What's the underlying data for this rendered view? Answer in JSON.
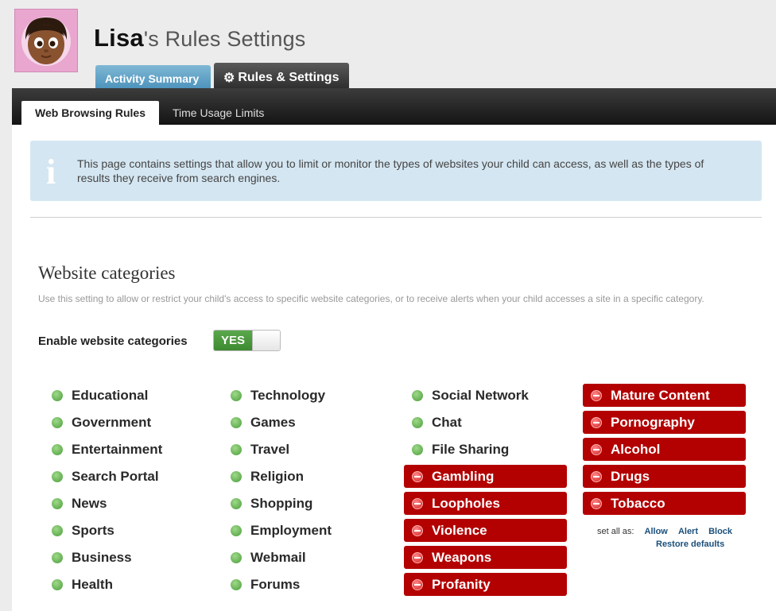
{
  "header": {
    "name": "Lisa",
    "title_suffix": "'s Rules Settings"
  },
  "tabs": {
    "activity": "Activity Summary",
    "rules": "Rules & Settings"
  },
  "subtabs": {
    "web": "Web Browsing Rules",
    "time": "Time Usage Limits"
  },
  "info": {
    "icon": "info-icon",
    "text": "This page contains settings that allow you to limit or monitor the types of websites your child can access, as well as the types of results they receive from search engines."
  },
  "section": {
    "title": "Website categories",
    "description": "Use this setting to allow or restrict your child's access to specific website categories, or to receive alerts when your child accesses a site in a specific category.",
    "enable_label": "Enable website categories",
    "toggle_label": "YES"
  },
  "colors": {
    "allow": "#4a9d39",
    "block": "#b30000",
    "tab_blue": "#4d93bc"
  },
  "categories": {
    "col1": [
      {
        "label": "Educational",
        "status": "allow"
      },
      {
        "label": "Government",
        "status": "allow"
      },
      {
        "label": "Entertainment",
        "status": "allow"
      },
      {
        "label": "Search Portal",
        "status": "allow"
      },
      {
        "label": "News",
        "status": "allow"
      },
      {
        "label": "Sports",
        "status": "allow"
      },
      {
        "label": "Business",
        "status": "allow"
      },
      {
        "label": "Health",
        "status": "allow"
      }
    ],
    "col2": [
      {
        "label": "Technology",
        "status": "allow"
      },
      {
        "label": "Games",
        "status": "allow"
      },
      {
        "label": "Travel",
        "status": "allow"
      },
      {
        "label": "Religion",
        "status": "allow"
      },
      {
        "label": "Shopping",
        "status": "allow"
      },
      {
        "label": "Employment",
        "status": "allow"
      },
      {
        "label": "Webmail",
        "status": "allow"
      },
      {
        "label": "Forums",
        "status": "allow"
      }
    ],
    "col3": [
      {
        "label": "Social Network",
        "status": "allow"
      },
      {
        "label": "Chat",
        "status": "allow"
      },
      {
        "label": "File Sharing",
        "status": "allow"
      },
      {
        "label": "Gambling",
        "status": "block"
      },
      {
        "label": "Loopholes",
        "status": "block"
      },
      {
        "label": "Violence",
        "status": "block"
      },
      {
        "label": "Weapons",
        "status": "block"
      },
      {
        "label": "Profanity",
        "status": "block"
      }
    ],
    "col4": [
      {
        "label": "Mature Content",
        "status": "block"
      },
      {
        "label": "Pornography",
        "status": "block"
      },
      {
        "label": "Alcohol",
        "status": "block"
      },
      {
        "label": "Drugs",
        "status": "block"
      },
      {
        "label": "Tobacco",
        "status": "block"
      }
    ]
  },
  "set_all": {
    "label": "set all as:",
    "allow": "Allow",
    "alert": "Alert",
    "block": "Block",
    "restore": "Restore defaults"
  }
}
